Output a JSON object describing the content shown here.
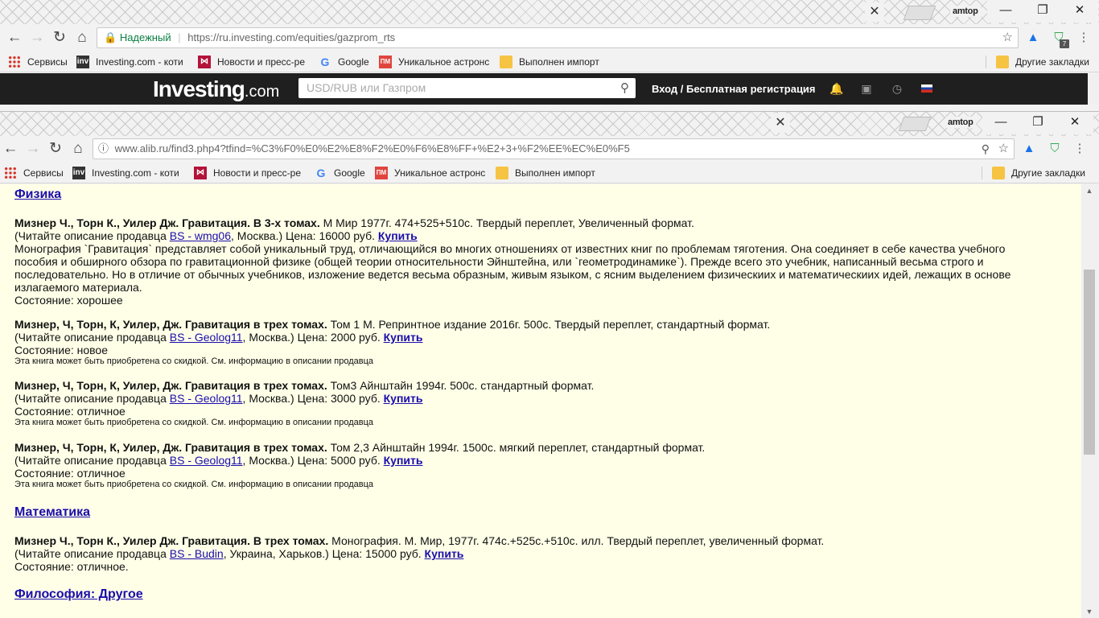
{
  "back_window": {
    "profile": "amtop",
    "security_label": "Надежный",
    "url": "https://ru.investing.com/equities/gazprom_rts",
    "extension_badge": "7",
    "bookmarks": {
      "apps": "Сервисы",
      "b1": "Investing.com - коти",
      "b2": "Новости и пресс-ре",
      "b3": "Google",
      "b4": "Уникальное астронс",
      "b5": "Выполнен импорт",
      "other": "Другие закладки"
    },
    "investing": {
      "logo_main": "Investing",
      "logo_suffix": ".com",
      "search_placeholder": "USD/RUB или Газпром",
      "login": "Вход / Бесплатная регистрация"
    }
  },
  "front_window": {
    "profile": "amtop",
    "url": "www.alib.ru/find3.php4?tfind=%C3%F0%E0%E2%E8%F2%E0%F6%E8%FF+%E2+3+%F2%EE%EC%E0%F5",
    "bookmarks": {
      "apps": "Сервисы",
      "b1": "Investing.com - коти",
      "b2": "Новости и пресс-ре",
      "b3": "Google",
      "b4": "Уникальное астронс",
      "b5": "Выполнен импорт",
      "other": "Другие закладки"
    }
  },
  "page": {
    "cat_physics": "Физика",
    "item1": {
      "title": "Мизнер Ч., Торн К., Уилер Дж. Гравитация. В 3-х томах.",
      "desc": " М Мир 1977г. 474+525+510с. Твердый переплет, Увеличенный формат.",
      "seller_pre": "(Читайте описание продавца ",
      "seller": "BS - wmg06",
      "seller_post": ", Москва.) Цена: 16000 руб. ",
      "buy": "Купить",
      "text1": "Монография `Гравитация` представляет собой уникальный труд, отличающийся во многих отношениях от известних книг по проблемам тяготения. Она соединяет в себе качества учебного",
      "text2": "пособия и обширного обзора по гравитационной физике (общей теории относительности Эйнштейна, или `геометродинамике`). Прежде всего это учебник, написанный весьма строго и",
      "text3": "последовательно. Но в отличие от обычных учебников, изложение ведется весьма образным, живым языком, с ясним выделением физическиих и математическиих идей, лежащих в основе",
      "text4": "излагаемого материала.",
      "state": "Состояние: хорошее"
    },
    "item2": {
      "title": "Мизнер, Ч, Торн, К, Уилер, Дж. Гравитация в трех томах.",
      "desc": " Том 1 М. Репринтное издание 2016г. 500с. Твердый переплет, стандартный формат.",
      "seller_pre": "(Читайте описание продавца ",
      "seller": "BS - Geolog11",
      "seller_post": ", Москва.) Цена: 2000 руб. ",
      "buy": "Купить",
      "state": "Состояние: новое",
      "note": "Эта книга может быть приобретена со скидкой. См. информацию в описании продавца"
    },
    "item3": {
      "title": "Мизнер, Ч, Торн, К, Уилер, Дж. Гравитация в трех томах.",
      "desc": " Том3 Айнштайн 1994г. 500с. стандартный формат.",
      "seller_pre": "(Читайте описание продавца ",
      "seller": "BS - Geolog11",
      "seller_post": ", Москва.) Цена: 3000 руб. ",
      "buy": "Купить",
      "state": "Состояние: отличное",
      "note": "Эта книга может быть приобретена со скидкой. См. информацию в описании продавца"
    },
    "item4": {
      "title": "Мизнер, Ч, Торн, К, Уилер, Дж. Гравитация в трех томах.",
      "desc": " Том 2,3 Айнштайн 1994г. 1500с. мягкий переплет, стандартный формат.",
      "seller_pre": "(Читайте описание продавца ",
      "seller": "BS - Geolog11",
      "seller_post": ", Москва.) Цена: 5000 руб. ",
      "buy": "Купить",
      "state": "Состояние: отличное",
      "note": "Эта книга может быть приобретена со скидкой. См. информацию в описании продавца"
    },
    "cat_math": "Математика",
    "item5": {
      "title": "Мизнер Ч., Торн К., Уилер Дж. Гравитация. В трех томах.",
      "desc": " Монография. М. Мир, 1977г. 474с.+525с.+510с. илл. Твердый переплет, увеличенный формат.",
      "seller_pre": "(Читайте описание продавца ",
      "seller": "BS - Budin",
      "seller_post": ", Украина, Харьков.) Цена: 15000 руб. ",
      "buy": "Купить",
      "state": "Состояние: отличное."
    },
    "cat_philosophy": "Философия: Другое"
  }
}
